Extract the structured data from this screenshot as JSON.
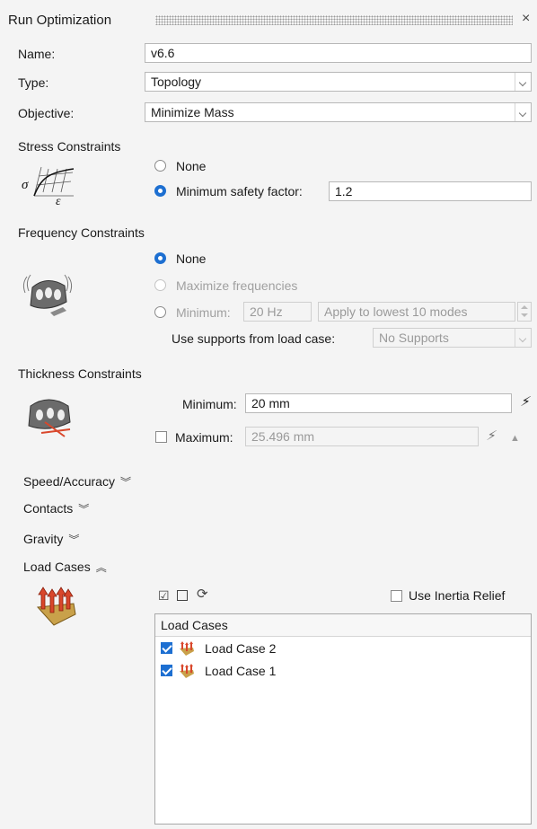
{
  "panel": {
    "title": "Run Optimization",
    "close_glyph": "×"
  },
  "name": {
    "label": "Name:",
    "value": "v6.6"
  },
  "type": {
    "label": "Type:",
    "value": "Topology"
  },
  "objective": {
    "label": "Objective:",
    "value": "Minimize Mass"
  },
  "stress": {
    "heading": "Stress Constraints",
    "icon": "stress-strain-graph-icon",
    "options": [
      {
        "label": "None",
        "selected": false
      },
      {
        "label": "Minimum safety factor:",
        "selected": true
      }
    ],
    "safety_factor_value": "1.2"
  },
  "frequency": {
    "heading": "Frequency Constraints",
    "icon": "vibrating-part-icon",
    "options": [
      {
        "label": "None",
        "selected": true
      },
      {
        "label": "Maximize frequencies",
        "selected": false
      },
      {
        "label": "Minimum:",
        "selected": false
      }
    ],
    "minimum_value": "20 Hz",
    "apply_to": "Apply to lowest 10 modes",
    "supports_label": "Use supports from load case:",
    "supports_value": "No Supports"
  },
  "thickness": {
    "heading": "Thickness Constraints",
    "icon": "thickness-part-icon",
    "minimum_label": "Minimum:",
    "minimum_value": "20 mm",
    "maximum_label": "Maximum:",
    "maximum_value": "25.496 mm"
  },
  "collapsibles": {
    "speed_accuracy": "Speed/Accuracy",
    "contacts": "Contacts",
    "gravity": "Gravity",
    "load_cases": "Load Cases"
  },
  "load_cases": {
    "icon": "load-case-icon",
    "use_inertia_relief": "Use Inertia Relief",
    "list_header": "Load Cases",
    "items": [
      {
        "label": "Load Case 2",
        "checked": true
      },
      {
        "label": "Load Case 1",
        "checked": true
      }
    ]
  },
  "colors": {
    "accent": "#1d6fd1",
    "load_arrow": "#d9472b"
  }
}
